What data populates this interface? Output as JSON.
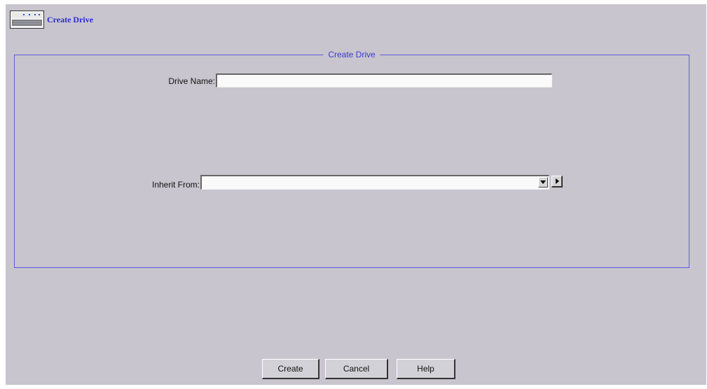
{
  "header": {
    "title": "Create Drive",
    "icon": "drive-icon"
  },
  "form": {
    "legend": "Create Drive",
    "drive_name_label": "Drive Name:",
    "drive_name_value": "",
    "inherit_from_label": "Inherit From:",
    "inherit_from_value": ""
  },
  "buttons": {
    "create": "Create",
    "cancel": "Cancel",
    "help": "Help"
  },
  "colors": {
    "panel_background": "#c8c5ce",
    "accent": "#3a3ad6"
  }
}
